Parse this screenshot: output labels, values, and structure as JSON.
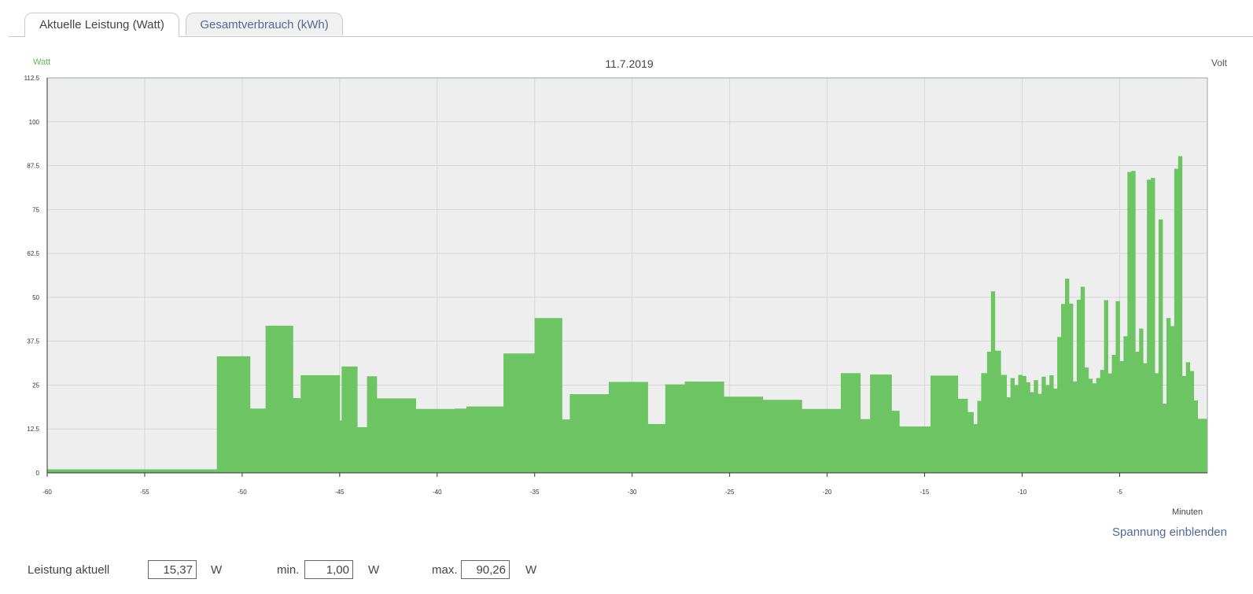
{
  "tabs": [
    {
      "label": "Aktuelle Leistung (Watt)",
      "active": true
    },
    {
      "label": "Gesamtverbrauch (kWh)",
      "active": false
    }
  ],
  "chart_header": {
    "left_unit": "Watt",
    "title": "11.7.2019",
    "right_unit": "Volt"
  },
  "x_axis_label": "Minuten",
  "toggle_voltage": "Spannung einblenden",
  "stats": {
    "current_label": "Leistung aktuell",
    "current_value": "15,37",
    "min_label": "min.",
    "min_value": "1,00",
    "max_label": "max.",
    "max_value": "90,26",
    "unit": "W"
  },
  "colors": {
    "bar_fill": "#6cc463",
    "plot_background": "#eeeeee",
    "grid": "#d6d6d6",
    "tab_link": "#4f6a98",
    "unit_label_green": "#63b64f"
  },
  "chart_data": {
    "type": "area",
    "title": "11.7.2019",
    "xlabel": "Minuten",
    "ylabel": "Watt",
    "xlim": [
      -60,
      -0.5
    ],
    "ylim": [
      0,
      112.5
    ],
    "yticks": [
      0,
      12.5,
      25,
      37.5,
      50,
      62.5,
      75,
      87.5,
      100,
      112.5
    ],
    "ytick_labels": [
      "0",
      "12.5",
      "25",
      "37.5",
      "50",
      "62.5",
      "75",
      "87.5",
      "100",
      "112.5"
    ],
    "xticks": [
      -60,
      -55,
      -50,
      -45,
      -40,
      -35,
      -30,
      -25,
      -20,
      -15,
      -10,
      -5
    ],
    "xtick_labels": [
      "-60",
      "-55",
      "-50",
      "-45",
      "-40",
      "-35",
      "-30",
      "-25",
      "-20",
      "-15",
      "-10",
      "-5"
    ],
    "grid": true,
    "series": [
      {
        "step_start_x": [
          -60,
          -51.3,
          -49.6,
          -48.8,
          -47.4,
          -47.0,
          -45.0,
          -44.9,
          -44.1,
          -43.6,
          -43.1,
          -41.1,
          -39.1,
          -38.5,
          -36.6,
          -35.0,
          -33.6,
          -33.2,
          -31.2,
          -29.2,
          -28.3,
          -27.3,
          -25.3,
          -23.3,
          -21.3,
          -19.3,
          -18.3,
          -17.8,
          -16.7,
          -16.3,
          -14.7,
          -13.3,
          -12.8,
          -12.5,
          -12.3,
          -12.1,
          -11.8,
          -11.6,
          -11.4,
          -11.1,
          -10.8,
          -10.6,
          -10.4,
          -10.2,
          -10.0,
          -9.8,
          -9.6,
          -9.4,
          -9.2,
          -9.0,
          -8.8,
          -8.6,
          -8.4,
          -8.2,
          -8.0,
          -7.8,
          -7.6,
          -7.4,
          -7.2,
          -7.0,
          -6.8,
          -6.6,
          -6.4,
          -6.2,
          -6.0,
          -5.8,
          -5.6,
          -5.4,
          -5.2,
          -5.0,
          -4.8,
          -4.6,
          -4.4,
          -4.2,
          -4.0,
          -3.8,
          -3.6,
          -3.4,
          -3.2,
          -3.0,
          -2.8,
          -2.6,
          -2.4,
          -2.2,
          -2.0,
          -1.8,
          -1.6,
          -1.4,
          -1.2,
          -1.0,
          -0.8,
          -0.6
        ],
        "values": [
          1.0,
          33.2,
          18.3,
          41.9,
          21.3,
          27.8,
          14.9,
          30.3,
          13.0,
          27.5,
          21.2,
          18.2,
          18.3,
          18.9,
          34.0,
          44.1,
          15.2,
          22.4,
          25.9,
          13.9,
          25.2,
          26.0,
          21.7,
          20.8,
          18.2,
          28.4,
          15.3,
          28.0,
          17.7,
          13.2,
          27.7,
          21.1,
          17.3,
          13.9,
          20.5,
          28.4,
          34.5,
          51.7,
          34.8,
          27.9,
          21.5,
          27.0,
          25.0,
          27.9,
          27.6,
          25.8,
          23.0,
          26.4,
          22.5,
          27.4,
          25.0,
          27.8,
          24.0,
          38.7,
          48.1,
          55.3,
          48.2,
          26.0,
          49.3,
          53.0,
          30.0,
          26.8,
          25.5,
          27.0,
          29.3,
          49.2,
          28.3,
          33.6,
          48.9,
          31.8,
          38.9,
          85.7,
          86.0,
          34.5,
          41.1,
          31.2,
          83.5,
          84.0,
          28.4,
          72.2,
          19.7,
          44.1,
          41.8,
          86.6,
          90.2,
          27.6,
          31.5,
          29.0,
          20.6,
          15.4,
          15.4,
          15.37
        ]
      }
    ]
  }
}
